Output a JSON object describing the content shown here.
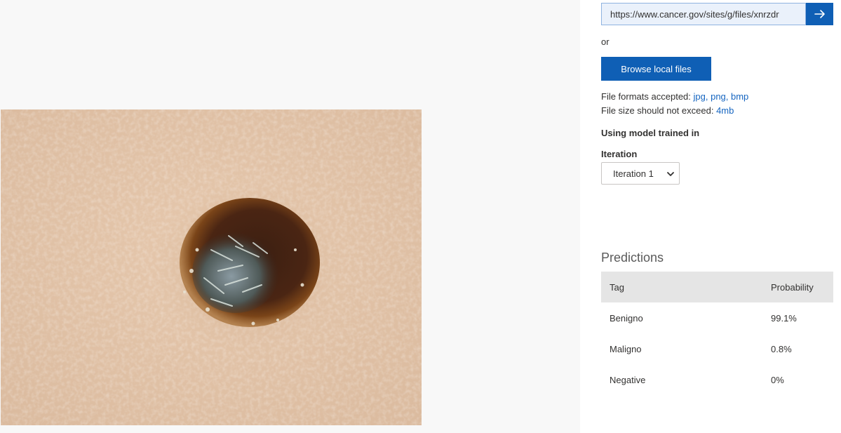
{
  "upload": {
    "url_value": "https://www.cancer.gov/sites/g/files/xnrzdr",
    "go_icon": "arrow-right-icon",
    "or_text": "or",
    "browse_label": "Browse local files",
    "formats_label": "File formats accepted:",
    "formats_value": "jpg, png, bmp",
    "size_label": "File size should not exceed:",
    "size_value": "4mb"
  },
  "model": {
    "trained_label": "Using model trained in",
    "iteration_label": "Iteration",
    "iteration_selected": "Iteration 1"
  },
  "predictions": {
    "title": "Predictions",
    "headers": [
      "Tag",
      "Probability"
    ],
    "rows": [
      {
        "tag": "Benigno",
        "probability": "99.1%"
      },
      {
        "tag": "Maligno",
        "probability": "0.8%"
      },
      {
        "tag": "Negative",
        "probability": "0%"
      }
    ]
  },
  "colors": {
    "accent": "#0f5fb5",
    "link": "#1565c0",
    "table_header_bg": "#e5e5e5"
  }
}
